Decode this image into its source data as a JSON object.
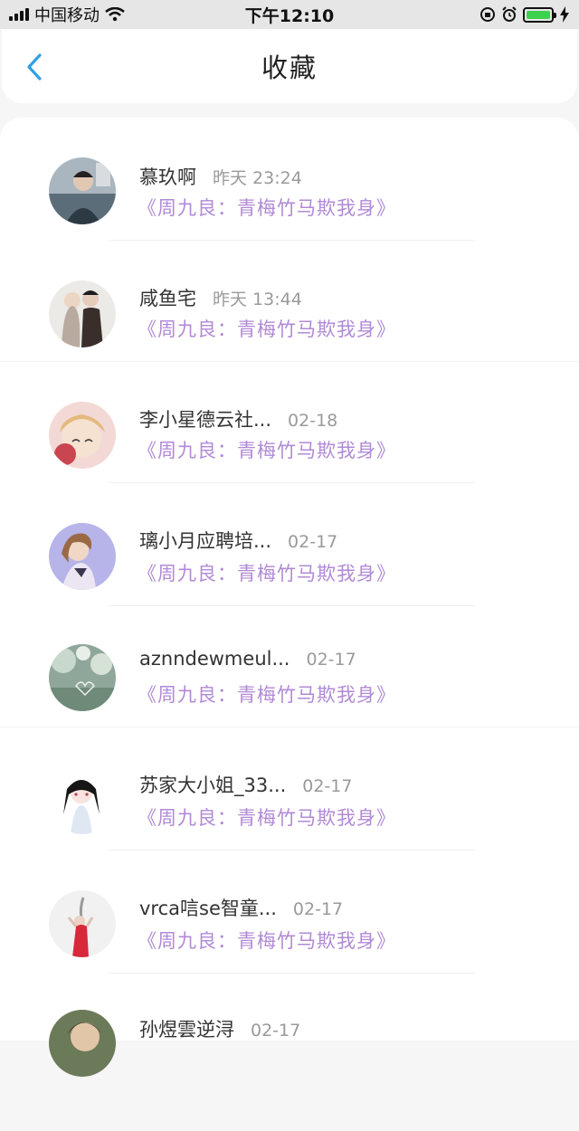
{
  "status_bar": {
    "carrier": "中国移动",
    "time": "下午12:10"
  },
  "header": {
    "title": "收藏"
  },
  "favorites": [
    {
      "user": "慕玖啊",
      "time": "昨天 23:24",
      "book": "《周九良：青梅竹马欺我身》"
    },
    {
      "user": "咸鱼宅",
      "time": "昨天 13:44",
      "book": "《周九良：青梅竹马欺我身》"
    },
    {
      "user": "李小星德云社...",
      "time": "02-18",
      "book": "《周九良：青梅竹马欺我身》"
    },
    {
      "user": "璃小月应聘培...",
      "time": "02-17",
      "book": "《周九良：青梅竹马欺我身》"
    },
    {
      "user": "aznndewmeul...",
      "time": "02-17",
      "book": "《周九良：青梅竹马欺我身》"
    },
    {
      "user": "苏家大小姐_33...",
      "time": "02-17",
      "book": "《周九良：青梅竹马欺我身》"
    },
    {
      "user": "vrca唁se智童...",
      "time": "02-17",
      "book": "《周九良：青梅竹马欺我身》"
    },
    {
      "user": "孙煜雲逆浔",
      "time": "02-17",
      "book": ""
    }
  ]
}
